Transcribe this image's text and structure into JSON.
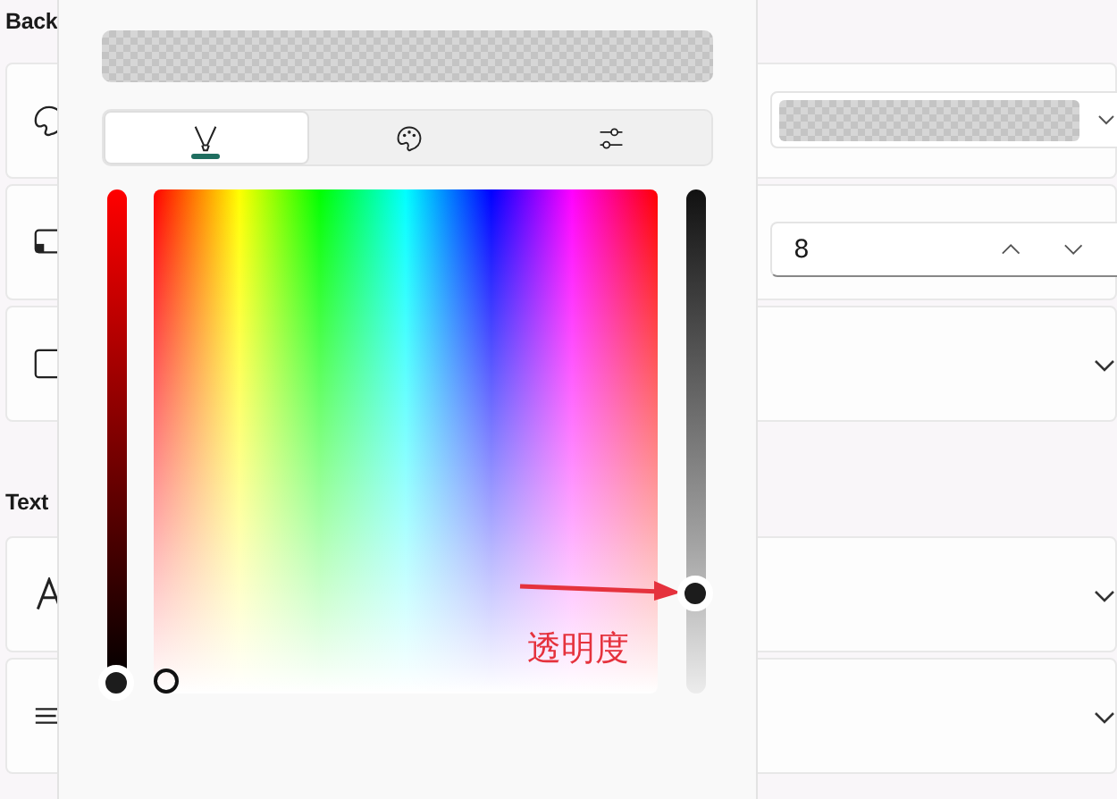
{
  "background_section": {
    "title": "Back"
  },
  "cards": [
    {
      "kind": "color-dropdown"
    },
    {
      "kind": "number",
      "value": "8"
    },
    {
      "kind": "expander"
    }
  ],
  "text_section": {
    "title": "Text"
  },
  "text_cards": [
    {
      "kind": "expander"
    },
    {
      "kind": "expander"
    }
  ],
  "color_picker": {
    "tabs": [
      {
        "kind": "pen",
        "selected": true
      },
      {
        "kind": "palette",
        "selected": false
      },
      {
        "kind": "sliders",
        "selected": false
      }
    ],
    "value_slider": {
      "level": 0
    },
    "alpha_slider": {
      "level": 0.2
    },
    "annotation": {
      "text": "透明度"
    }
  }
}
